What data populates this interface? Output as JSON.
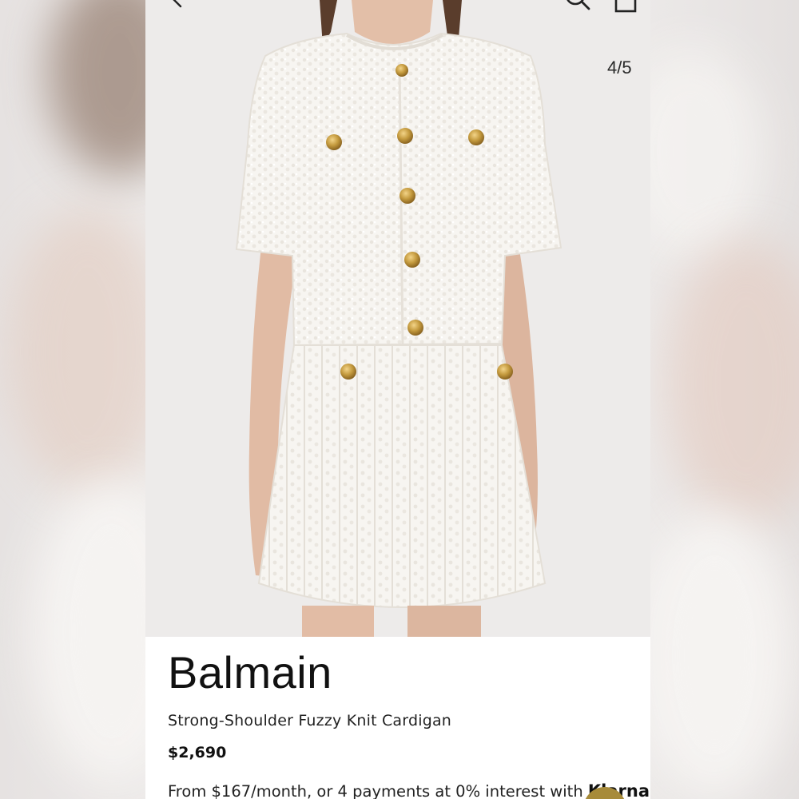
{
  "nav": {
    "back_icon": "chevron-left-icon",
    "search_icon": "search-icon",
    "bag_icon": "shopping-bag-icon"
  },
  "gallery": {
    "counter": "4/5",
    "image": "model-wearing-white-fuzzy-knit-cardigan-and-skirt"
  },
  "product": {
    "brand": "Balmain",
    "name": "Strong-Shoulder Fuzzy Knit Cardigan",
    "price": "$2,690",
    "installments_text": "From $167/month, or 4 payments at 0% interest with ",
    "installments_provider": "Klarna"
  },
  "colors": {
    "garment": "#f6f4f0",
    "buttons_gold": "#c49a3e",
    "background": "#edebea",
    "chat_bubble": "#a78b3a"
  }
}
